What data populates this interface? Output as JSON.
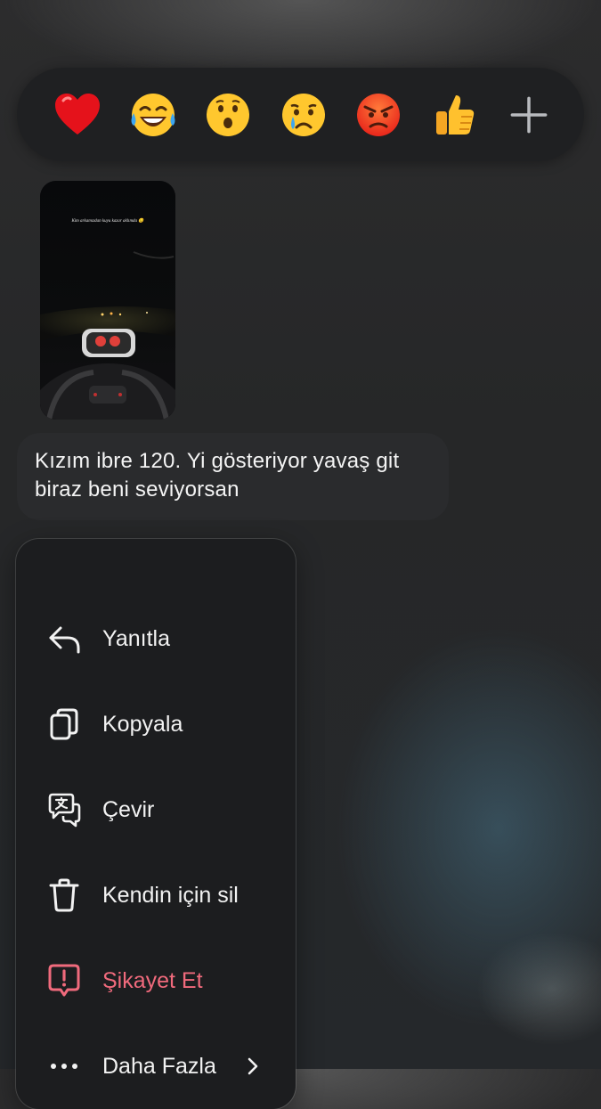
{
  "reactions": [
    {
      "icon": "red-heart-emoji"
    },
    {
      "icon": "tears-of-joy-emoji"
    },
    {
      "icon": "surprised-face-emoji"
    },
    {
      "icon": "crying-face-emoji"
    },
    {
      "icon": "angry-face-emoji"
    },
    {
      "icon": "thumbs-up-emoji"
    }
  ],
  "add_reaction_icon": "plus-icon",
  "story_preview": {
    "caption": "Kim arkamızdan kuyu kazar aklımda 😏"
  },
  "message": {
    "text": "Kızım ibre 120. Yi gösteriyor yavaş git biraz beni seviyorsan"
  },
  "menu": {
    "items": [
      {
        "label": "Yanıtla",
        "icon": "reply-arrow-icon"
      },
      {
        "label": "Kopyala",
        "icon": "copy-icon"
      },
      {
        "label": "Çevir",
        "icon": "translate-icon"
      },
      {
        "label": "Kendin için sil",
        "icon": "trash-icon"
      },
      {
        "label": "Şikayet Et",
        "icon": "report-icon"
      },
      {
        "label": "Daha Fazla",
        "icon": "more-dots-icon"
      }
    ]
  },
  "colors": {
    "danger": "#f06a7c",
    "menu_bg": "#1c1d1f",
    "bubble_bg": "#2a2b2d"
  }
}
